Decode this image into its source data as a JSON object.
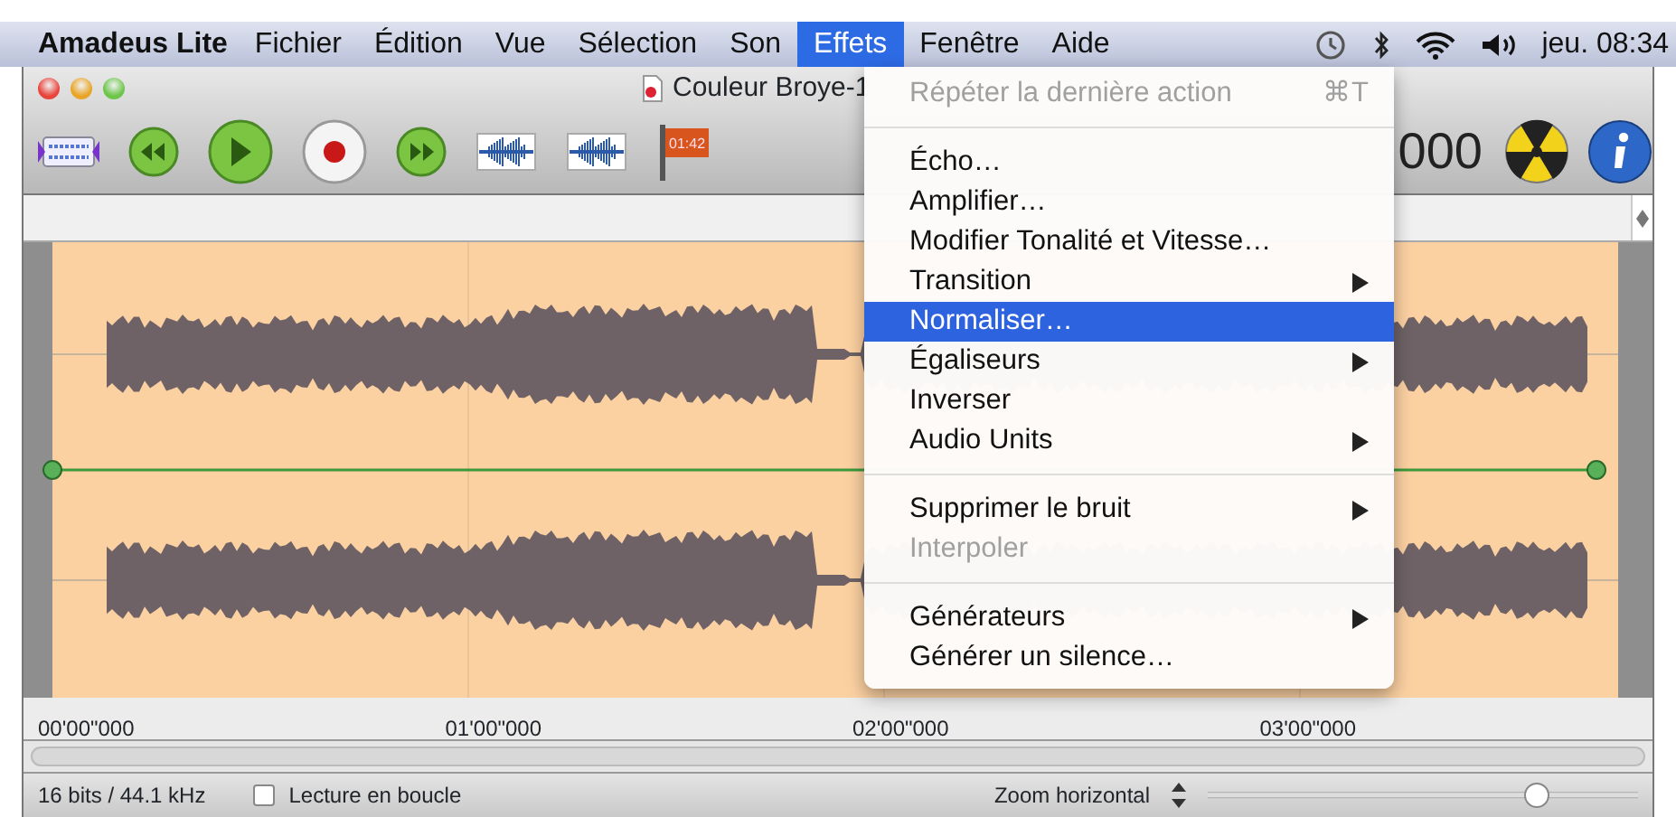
{
  "menubar": {
    "app": "Amadeus Lite",
    "menus": [
      {
        "label": "Fichier",
        "selected": false
      },
      {
        "label": "Édition",
        "selected": false
      },
      {
        "label": "Vue",
        "selected": false
      },
      {
        "label": "Sélection",
        "selected": false
      },
      {
        "label": "Son",
        "selected": false
      },
      {
        "label": "Effets",
        "selected": true
      },
      {
        "label": "Fenêtre",
        "selected": false
      },
      {
        "label": "Aide",
        "selected": false
      }
    ],
    "clock": "jeu. 08:34"
  },
  "window": {
    "title": "Couleur Broye-1",
    "flag_label": "01:42",
    "timer": "000"
  },
  "menu": [
    {
      "kind": "item",
      "label": "Répéter la dernière action",
      "shortcut": "⌘T",
      "disabled": true,
      "submenu": false,
      "selected": false
    },
    {
      "kind": "separator"
    },
    {
      "kind": "item",
      "label": "Écho…",
      "disabled": false,
      "submenu": false,
      "selected": false
    },
    {
      "kind": "item",
      "label": "Amplifier…",
      "disabled": false,
      "submenu": false,
      "selected": false
    },
    {
      "kind": "item",
      "label": "Modifier Tonalité et Vitesse…",
      "disabled": false,
      "submenu": false,
      "selected": false
    },
    {
      "kind": "item",
      "label": "Transition",
      "disabled": false,
      "submenu": true,
      "selected": false
    },
    {
      "kind": "item",
      "label": "Normaliser…",
      "disabled": false,
      "submenu": false,
      "selected": true
    },
    {
      "kind": "item",
      "label": "Égaliseurs",
      "disabled": false,
      "submenu": true,
      "selected": false
    },
    {
      "kind": "item",
      "label": "Inverser",
      "disabled": false,
      "submenu": false,
      "selected": false
    },
    {
      "kind": "item",
      "label": "Audio Units",
      "disabled": false,
      "submenu": true,
      "selected": false
    },
    {
      "kind": "separator"
    },
    {
      "kind": "item",
      "label": "Supprimer le bruit",
      "disabled": false,
      "submenu": true,
      "selected": false
    },
    {
      "kind": "item",
      "label": "Interpoler",
      "disabled": true,
      "submenu": false,
      "selected": false
    },
    {
      "kind": "separator"
    },
    {
      "kind": "item",
      "label": "Générateurs",
      "disabled": false,
      "submenu": true,
      "selected": false
    },
    {
      "kind": "item",
      "label": "Générer un silence…",
      "disabled": false,
      "submenu": false,
      "selected": false
    }
  ],
  "timeline": {
    "labels": [
      "00'00\"000",
      "01'00\"000",
      "02'00\"000",
      "03'00\"000"
    ]
  },
  "status_bar": {
    "format": "16 bits / 44.1 kHz",
    "loop": {
      "label": "Lecture en boucle",
      "checked": false
    },
    "zoom_label": "Zoom horizontal",
    "zoom": {
      "level": 0.78
    }
  }
}
